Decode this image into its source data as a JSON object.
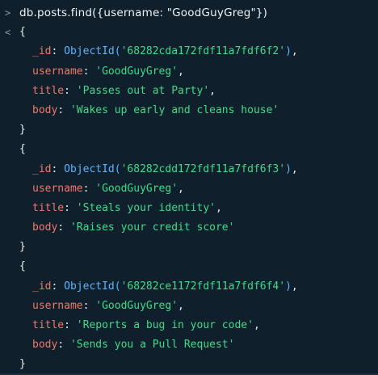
{
  "prompt_symbol": ">",
  "command": "db.posts.find({username: \"GoodGuyGreg\"})",
  "output_marker": "<",
  "documents": [
    {
      "id": "68282cda172fdf11a7fdf6f2",
      "username": "GoodGuyGreg",
      "title": "Passes out at Party",
      "body": "Wakes up early and cleans house"
    },
    {
      "id": "68282cdd172fdf11a7fdf6f3",
      "username": "GoodGuyGreg",
      "title": "Steals your identity",
      "body": "Raises your credit score"
    },
    {
      "id": "68282ce1172fdf11a7fdf6f4",
      "username": "GoodGuyGreg",
      "title": "Reports a bug in your code",
      "body": "Sends you a Pull Request"
    }
  ],
  "syntax": {
    "open_brace": "{",
    "close_brace": "}",
    "id_key": "_id",
    "username_key": "username",
    "title_key": "title",
    "body_key": "body",
    "objectid_fn": "ObjectId"
  },
  "colors": {
    "background": "#0f1f2b",
    "key": "#f07a6a",
    "string": "#3fdc8a",
    "objectid": "#5eb3ff",
    "text": "#e8edf0"
  }
}
